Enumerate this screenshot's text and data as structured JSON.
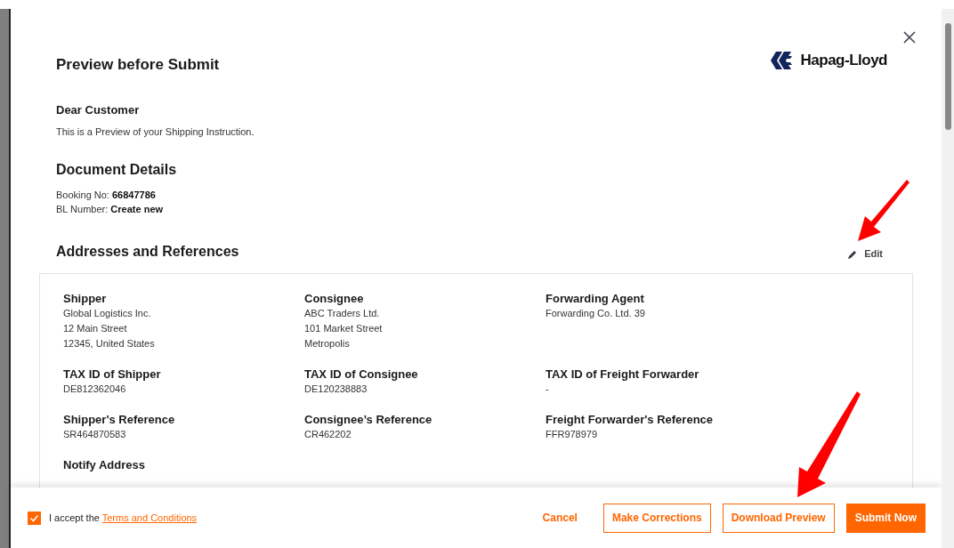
{
  "dialog": {
    "title": "Preview before Submit",
    "logo_text": "Hapag-Lloyd",
    "greeting": "Dear Customer",
    "intro": "This is a Preview of your Shipping Instruction.",
    "document_details": {
      "heading": "Document Details",
      "fields": [
        {
          "label": "Booking No:",
          "value": "66847786"
        },
        {
          "label": "BL Number:",
          "value": "Create new"
        }
      ]
    },
    "addresses": {
      "heading": "Addresses and References",
      "edit_label": "Edit",
      "items": [
        {
          "label": "Shipper",
          "lines": [
            "Global Logistics Inc.",
            "12 Main Street",
            "12345, United States"
          ]
        },
        {
          "label": "Consignee",
          "lines": [
            "ABC Traders Ltd.",
            "101 Market Street",
            "Metropolis"
          ]
        },
        {
          "label": "Forwarding Agent",
          "lines": [
            "Forwarding Co. Ltd. 39"
          ]
        },
        {
          "label": "TAX ID of Shipper",
          "lines": [
            "DE812362046"
          ]
        },
        {
          "label": "TAX ID of Consignee",
          "lines": [
            "DE120238883"
          ]
        },
        {
          "label": "TAX ID of Freight Forwarder",
          "lines": [
            "-"
          ]
        },
        {
          "label": "Shipper's Reference",
          "lines": [
            "SR464870583"
          ]
        },
        {
          "label": "Consignee’s Reference",
          "lines": [
            "CR462202"
          ]
        },
        {
          "label": "Freight Forwarder's Reference",
          "lines": [
            "FFR978979"
          ]
        },
        {
          "label": "Notify Address"
        }
      ]
    }
  },
  "footer": {
    "accept": {
      "checked": true,
      "text": "I accept the",
      "link": "Terms and Conditions"
    },
    "buttons": [
      {
        "label": "Cancel",
        "kind": "text"
      },
      {
        "label": "Make Corrections",
        "kind": "outline"
      },
      {
        "label": "Download Preview",
        "kind": "outline"
      },
      {
        "label": "Submit Now",
        "kind": "primary"
      }
    ]
  }
}
